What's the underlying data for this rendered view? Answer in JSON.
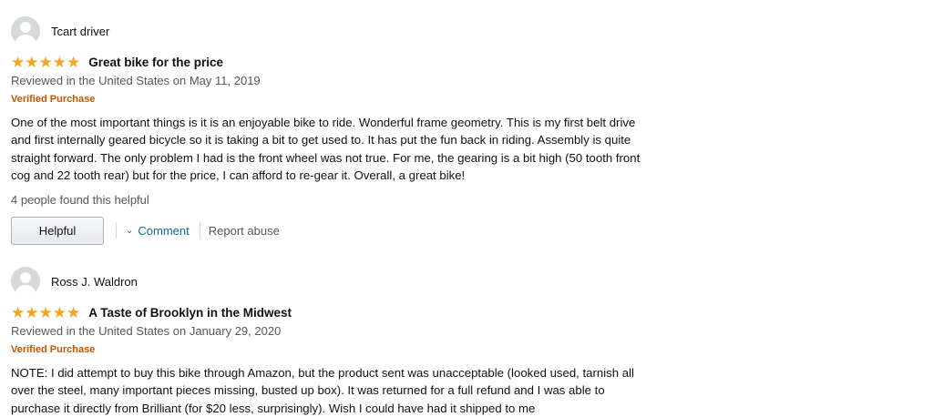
{
  "reviews": [
    {
      "author": "Tcart driver",
      "rating": 5,
      "title": "Great bike for the price",
      "date": "Reviewed in the United States on May 11, 2019",
      "verified": "Verified Purchase",
      "text": "One of the most important things is it is an enjoyable bike to ride. Wonderful frame geometry. This is my first belt drive and first internally geared bicycle so it is taking a bit to get used to. It has put the fun back in riding. Assembly is quite straight forward. The only problem I had is the front wheel was not true. For me, the gearing is a bit high (50 tooth front cog and 22 tooth rear) but for the price, I can afford to re-gear it. Overall, a great bike!",
      "helpful_count": "4 people found this helpful",
      "helpful_label": "Helpful",
      "comment_label": "Comment",
      "report_label": "Report abuse"
    },
    {
      "author": "Ross J. Waldron",
      "rating": 5,
      "title": "A Taste of Brooklyn in the Midwest",
      "date": "Reviewed in the United States on January 29, 2020",
      "verified": "Verified Purchase",
      "text": "NOTE: I did attempt to buy this bike through Amazon, but the product sent was unacceptable (looked used, tarnish all over the steel, many important pieces missing, busted up box). It was returned for a full refund and I was able to purchase it directly from Brilliant (for $20 less, surprisingly). Wish I could have had it shipped to me"
    }
  ],
  "colors": {
    "star": "#f4a41d",
    "verified": "#c45500",
    "link": "#0f6c9c",
    "muted": "#565959"
  },
  "icons": {
    "avatar": "default-avatar-icon",
    "star": "star-icon",
    "chevron": "chevron-down-icon"
  }
}
